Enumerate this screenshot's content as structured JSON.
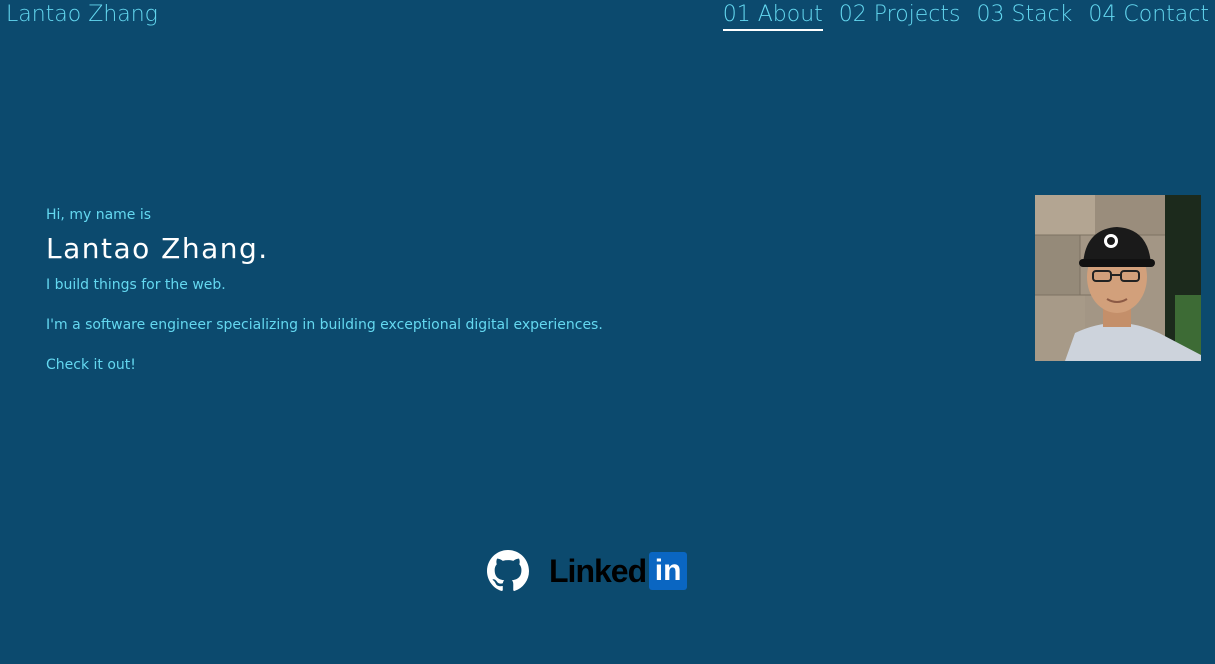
{
  "header": {
    "brand": "Lantao Zhang",
    "nav": [
      {
        "label": "01 About",
        "active": true
      },
      {
        "label": "02 Projects",
        "active": false
      },
      {
        "label": "03 Stack",
        "active": false
      },
      {
        "label": "04 Contact",
        "active": false
      }
    ]
  },
  "hero": {
    "greeting": "Hi, my name is",
    "name": "Lantao Zhang.",
    "tagline": "I build things for the web.",
    "description": "I'm a software engineer specializing in building exceptional digital experiences.",
    "cta": "Check it out!"
  },
  "social": {
    "github_icon": "github-icon",
    "linkedin_wordmark": "Linked",
    "linkedin_badge": "in"
  },
  "colors": {
    "background": "#0c4a6e",
    "accent": "#64d8f0",
    "heading": "#ffffff",
    "linkedin_blue": "#0a66c2"
  }
}
